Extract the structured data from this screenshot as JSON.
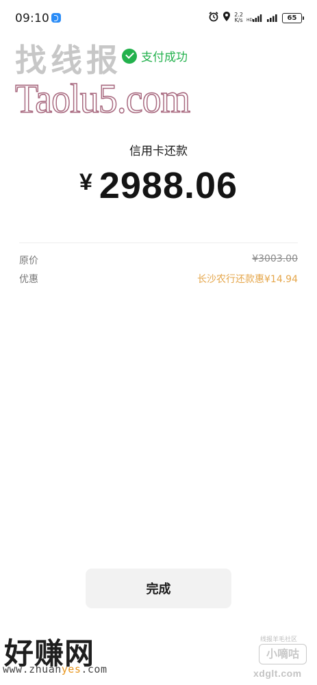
{
  "status_bar": {
    "time": "09:10",
    "app_icon": "blue-app-icon",
    "alarm_icon": "alarm-clock-icon",
    "location_icon": "location-pin-icon",
    "net_speed_value": "2.2",
    "net_speed_unit": "K/s",
    "signal_icons": [
      "cellular-signal-icon",
      "cellular-signal-icon"
    ],
    "battery_level": "65"
  },
  "watermarks": {
    "top": "找线报",
    "taolu": "Taolu5.com",
    "bottom_left_title": "好赚网",
    "bottom_left_url_prefix": "www.zhuan",
    "bottom_left_url_accent": "yes",
    "bottom_left_url_suffix": ".com",
    "bottom_right_caption": "线报羊毛社区",
    "bottom_right_badge": "小嘀咕",
    "bottom_right_url": "xdglt.com"
  },
  "payment": {
    "status_text": "支付成功",
    "status_icon": "check-circle-icon",
    "trade_name": "信用卡还款",
    "currency_symbol": "¥",
    "amount": "2988.06",
    "details": {
      "original_label": "原价",
      "original_value": "¥3003.00",
      "discount_label": "优惠",
      "discount_value": "长沙农行还款惠¥14.94"
    }
  },
  "actions": {
    "done_label": "完成"
  },
  "colors": {
    "success_green": "#22b14c",
    "discount_orange": "#e5a64a",
    "button_bg": "#f2f2f2"
  }
}
